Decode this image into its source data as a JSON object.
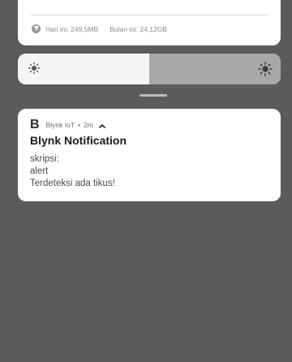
{
  "data_usage": {
    "today": "Hari ini: 249,5MB",
    "month": "Bulan ini: 24,12GB"
  },
  "brightness": {
    "level_percent": 50
  },
  "notification": {
    "app_name": "Blynk IoT",
    "separator": "•",
    "time": "2m",
    "title": "Blynk Notification",
    "lines": [
      "skripsi:",
      "alert",
      "Terdeteksi ada tikus!"
    ]
  },
  "icons": {
    "data": "mobile-data-icon",
    "brightness_low": "brightness-low-icon",
    "brightness_high": "brightness-high-icon",
    "app": "blynk-logo-icon",
    "expand": "chevron-up-icon"
  },
  "colors": {
    "background": "#5b5b5b",
    "card": "#ffffff",
    "slider_fill": "#f5f5f5",
    "slider_rest": "#a8a8a8"
  }
}
